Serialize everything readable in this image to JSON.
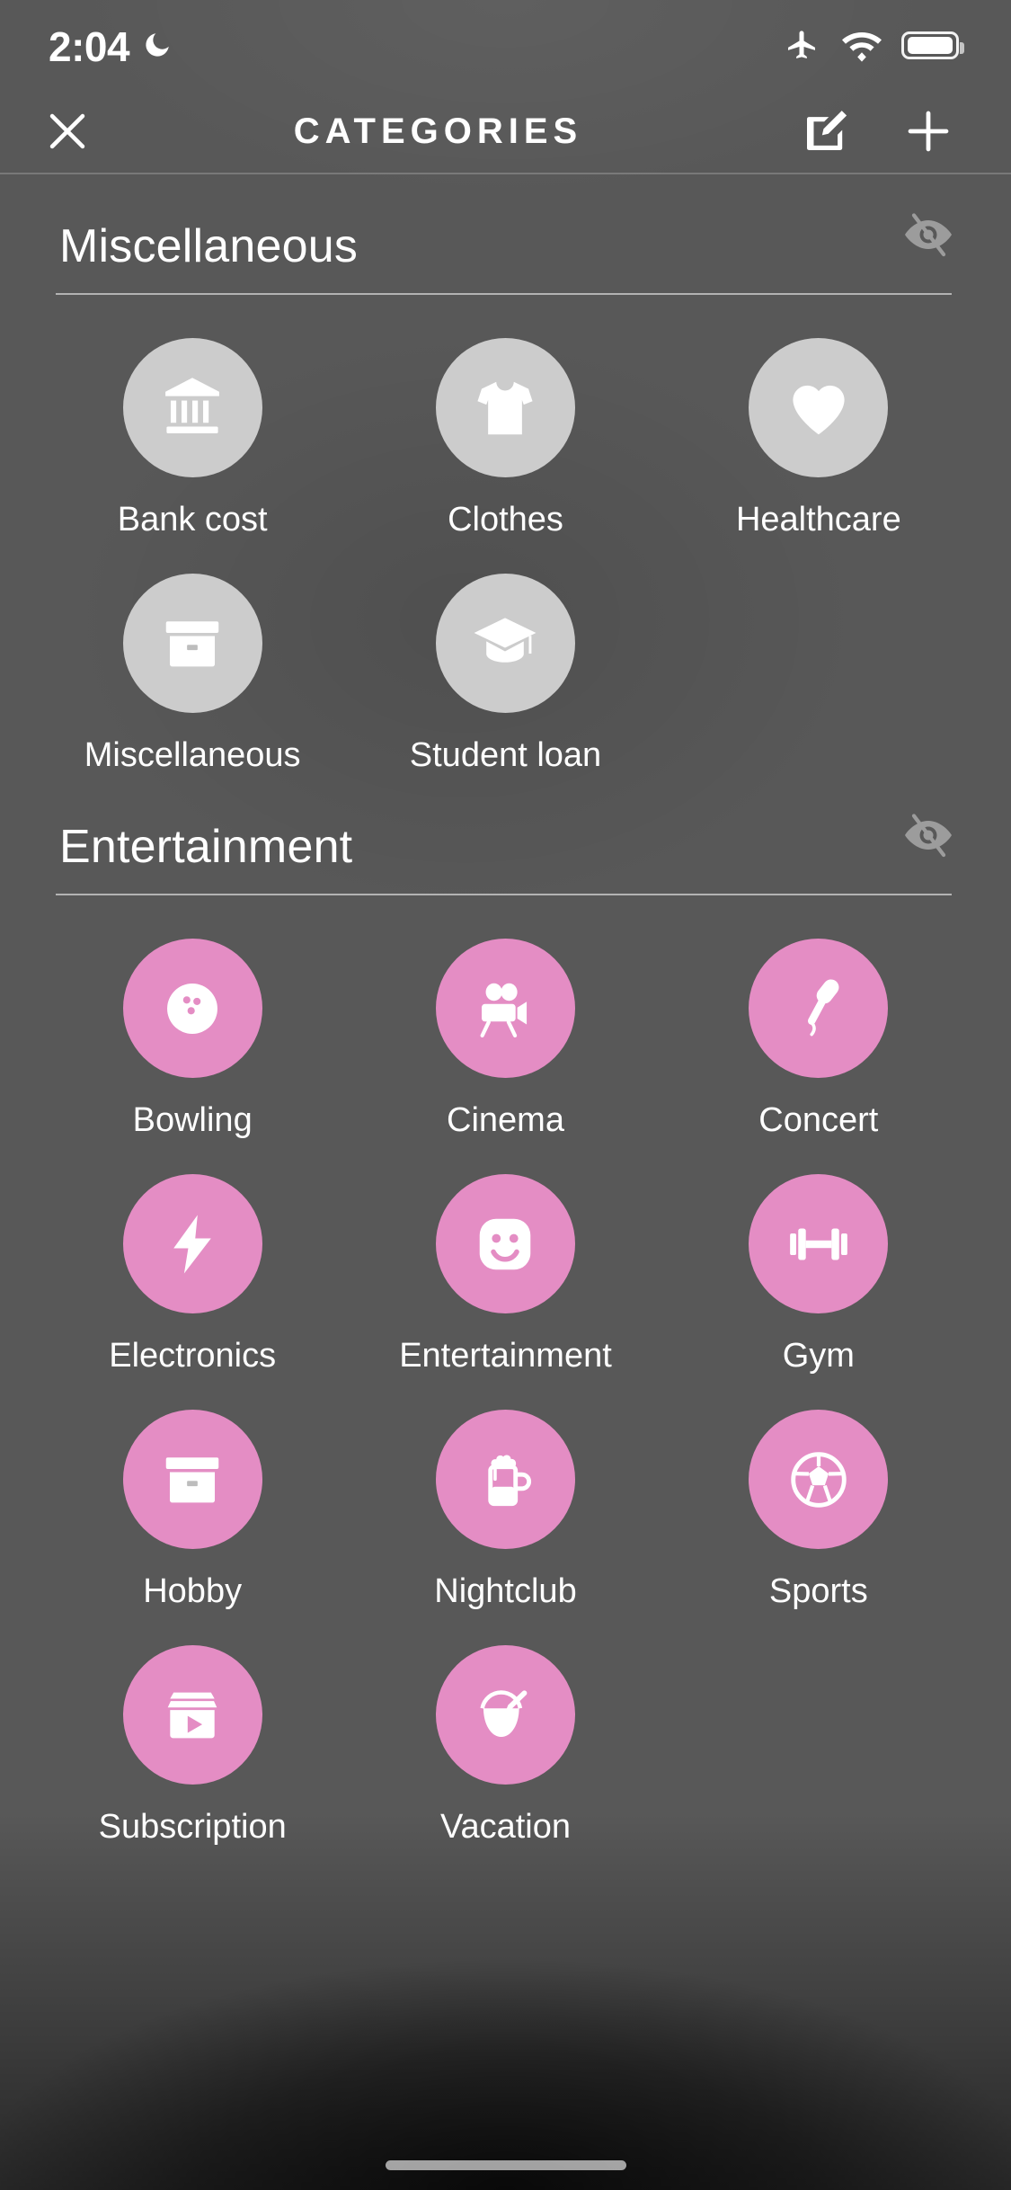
{
  "status_bar": {
    "time": "2:04",
    "dnd_icon": "crescent-moon-icon",
    "airplane_icon": "airplane-mode-icon",
    "wifi_icon": "wifi-icon",
    "battery_icon": "battery-full-icon"
  },
  "header": {
    "close_label": "close",
    "title": "CATEGORIES",
    "edit_label": "edit",
    "add_label": "add"
  },
  "colors": {
    "background": "#585858",
    "gray_bubble": "#cccccc",
    "pink_bubble": "#e48dc4",
    "text": "#ffffff"
  },
  "sections": [
    {
      "title": "Miscellaneous",
      "visibility_icon": "eye-slash-icon",
      "bubble_style": "gray",
      "items": [
        {
          "label": "Bank cost",
          "icon": "bank-icon"
        },
        {
          "label": "Clothes",
          "icon": "tshirt-icon"
        },
        {
          "label": "Healthcare",
          "icon": "heart-icon"
        },
        {
          "label": "Miscellaneous",
          "icon": "box-icon"
        },
        {
          "label": "Student loan",
          "icon": "graduation-cap-icon"
        }
      ]
    },
    {
      "title": "Entertainment",
      "visibility_icon": "eye-slash-icon",
      "bubble_style": "pink",
      "items": [
        {
          "label": "Bowling",
          "icon": "bowling-ball-icon"
        },
        {
          "label": "Cinema",
          "icon": "movie-camera-icon"
        },
        {
          "label": "Concert",
          "icon": "microphone-icon"
        },
        {
          "label": "Electronics",
          "icon": "lightning-bolt-icon"
        },
        {
          "label": "Entertainment",
          "icon": "smiley-face-icon"
        },
        {
          "label": "Gym",
          "icon": "dumbbell-icon"
        },
        {
          "label": "Hobby",
          "icon": "box-icon"
        },
        {
          "label": "Nightclub",
          "icon": "beer-mug-icon"
        },
        {
          "label": "Sports",
          "icon": "soccer-ball-icon"
        },
        {
          "label": "Subscription",
          "icon": "media-play-box-icon"
        },
        {
          "label": "Vacation",
          "icon": "coconut-drink-icon"
        }
      ]
    }
  ],
  "home_indicator": "home-indicator"
}
